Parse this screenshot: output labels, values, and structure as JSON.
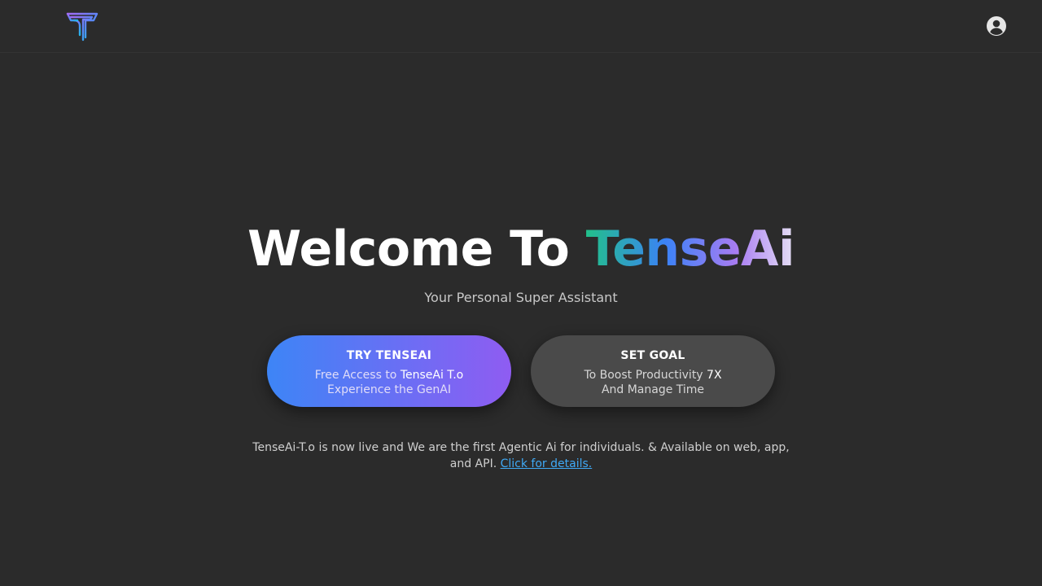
{
  "header": {
    "logo_icon": "tenseai-logo-icon",
    "account_icon": "user-circle-icon"
  },
  "hero": {
    "title_prefix": "Welcome To ",
    "title_brand": "TenseAi",
    "subtitle": "Your Personal Super Assistant"
  },
  "cta_try": {
    "label": "TRY TENSEAI",
    "line1_prefix": "Free Access to ",
    "line1_highlight": "TenseAi T.o",
    "line2": "Experience the GenAI"
  },
  "cta_goal": {
    "label": "SET GOAL",
    "line1_prefix": "To Boost Productivity ",
    "line1_highlight": "7X",
    "line2": "And Manage Time"
  },
  "notice": {
    "text": "TenseAi-T.o is now live and We are the first Agentic Ai for individuals. & Available on web, app, and API. ",
    "link": "Click for details."
  },
  "colors": {
    "background": "#2b2b2b",
    "cta_try_start": "#3d85f6",
    "cta_try_end": "#8f5cf2",
    "cta_goal_bg": "#4a4a4a",
    "link": "#3fa9f5"
  }
}
